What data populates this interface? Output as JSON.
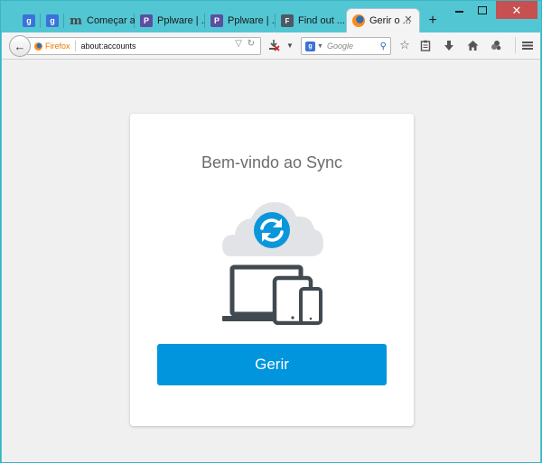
{
  "tabs": [
    {
      "favicon": "google-g-icon",
      "favicon_text": "g",
      "label": ""
    },
    {
      "favicon": "google-g-icon",
      "favicon_text": "g",
      "label": ""
    },
    {
      "favicon": "m-icon",
      "favicon_text": "m",
      "label": "Começar a..."
    },
    {
      "favicon": "pplware-icon",
      "favicon_text": "P",
      "label": "Pplware | ..."
    },
    {
      "favicon": "pplware-icon",
      "favicon_text": "P",
      "label": "Pplware | ..."
    },
    {
      "favicon": "page-icon",
      "favicon_text": "F",
      "label": "Find out ..."
    },
    {
      "favicon": "firefox-icon",
      "favicon_text": "",
      "label": "Gerir o ..."
    }
  ],
  "navbar": {
    "identity_label": "Firefox",
    "url": "about:accounts",
    "search_placeholder": "Google",
    "search_engine_letter": "g"
  },
  "page": {
    "title": "Bem-vindo ao Sync",
    "button_label": "Gerir"
  },
  "colors": {
    "titlebar": "#52c6d3",
    "accent_button": "#0095dd",
    "card_bg": "#ffffff",
    "content_bg": "#f0f0f0"
  }
}
